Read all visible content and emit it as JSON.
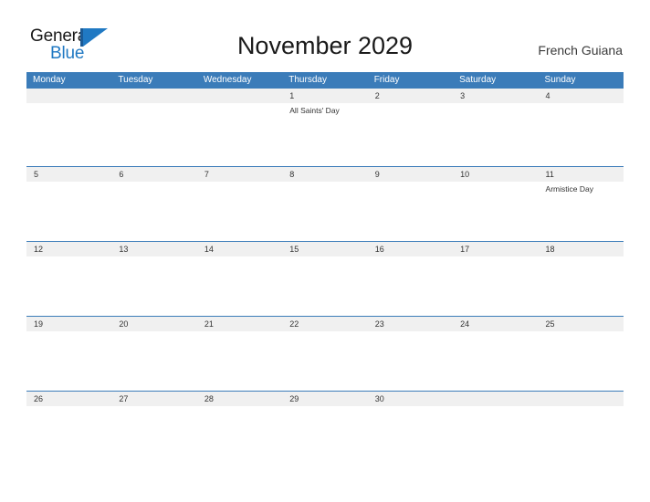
{
  "brand": {
    "name_part1": "General",
    "name_part2": "Blue",
    "mark": "triangle-flag-icon"
  },
  "header": {
    "title": "November 2029",
    "region": "French Guiana"
  },
  "calendar": {
    "month": "November",
    "year": "2029",
    "weekday_headers": [
      "Monday",
      "Tuesday",
      "Wednesday",
      "Thursday",
      "Friday",
      "Saturday",
      "Sunday"
    ],
    "weeks": [
      {
        "days": [
          {
            "num": "",
            "event": ""
          },
          {
            "num": "",
            "event": ""
          },
          {
            "num": "",
            "event": ""
          },
          {
            "num": "1",
            "event": "All Saints' Day"
          },
          {
            "num": "2",
            "event": ""
          },
          {
            "num": "3",
            "event": ""
          },
          {
            "num": "4",
            "event": ""
          }
        ]
      },
      {
        "days": [
          {
            "num": "5",
            "event": ""
          },
          {
            "num": "6",
            "event": ""
          },
          {
            "num": "7",
            "event": ""
          },
          {
            "num": "8",
            "event": ""
          },
          {
            "num": "9",
            "event": ""
          },
          {
            "num": "10",
            "event": ""
          },
          {
            "num": "11",
            "event": "Armistice Day"
          }
        ]
      },
      {
        "days": [
          {
            "num": "12",
            "event": ""
          },
          {
            "num": "13",
            "event": ""
          },
          {
            "num": "14",
            "event": ""
          },
          {
            "num": "15",
            "event": ""
          },
          {
            "num": "16",
            "event": ""
          },
          {
            "num": "17",
            "event": ""
          },
          {
            "num": "18",
            "event": ""
          }
        ]
      },
      {
        "days": [
          {
            "num": "19",
            "event": ""
          },
          {
            "num": "20",
            "event": ""
          },
          {
            "num": "21",
            "event": ""
          },
          {
            "num": "22",
            "event": ""
          },
          {
            "num": "23",
            "event": ""
          },
          {
            "num": "24",
            "event": ""
          },
          {
            "num": "25",
            "event": ""
          }
        ]
      },
      {
        "days": [
          {
            "num": "26",
            "event": ""
          },
          {
            "num": "27",
            "event": ""
          },
          {
            "num": "28",
            "event": ""
          },
          {
            "num": "29",
            "event": ""
          },
          {
            "num": "30",
            "event": ""
          },
          {
            "num": "",
            "event": ""
          },
          {
            "num": "",
            "event": ""
          }
        ]
      }
    ]
  },
  "colors": {
    "header_blue": "#3b7cb9",
    "rule_blue": "#3b7cb9",
    "number_band": "#f0f0f0",
    "brand_blue": "#2079c3",
    "text_dark": "#333333",
    "page_background": "#ffffff"
  }
}
